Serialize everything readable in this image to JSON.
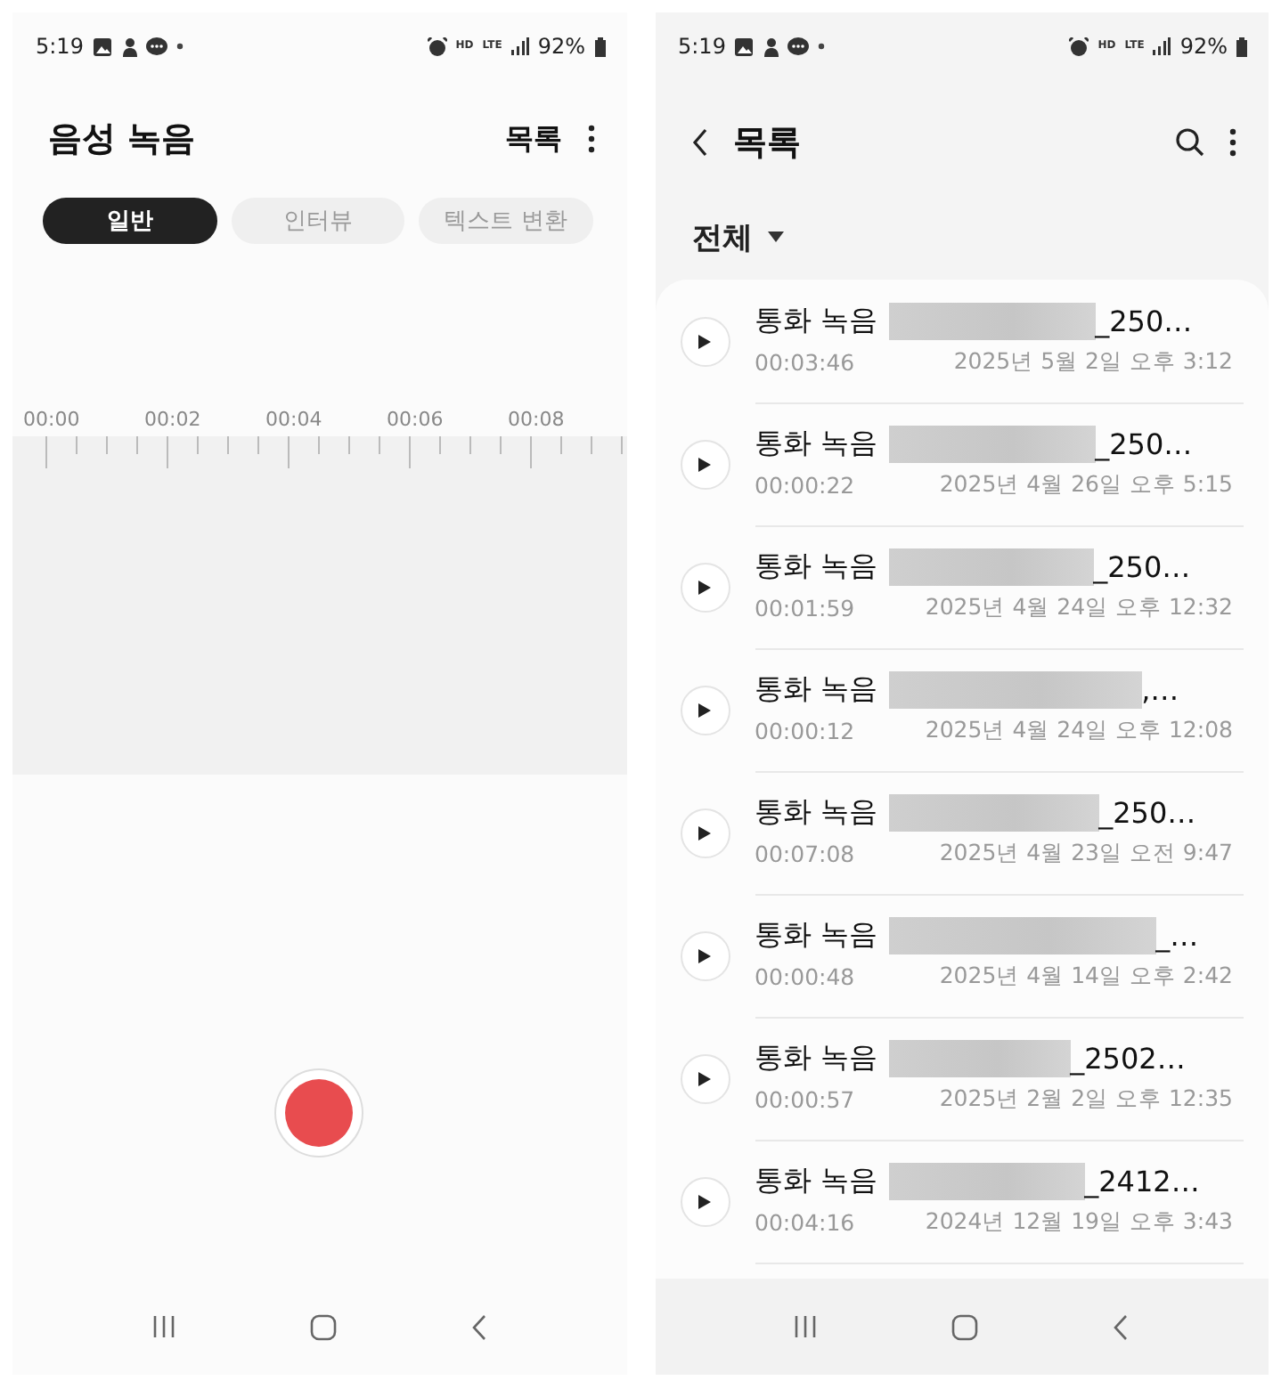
{
  "screens": [
    {
      "status_bar": {
        "time": "5:19",
        "network_labels": [
          "HD",
          "LTE"
        ],
        "battery": "92%"
      },
      "title": "음성 녹음",
      "list_button": "목록",
      "tabs": [
        {
          "label": "일반",
          "selected": true
        },
        {
          "label": "인터뷰",
          "selected": false
        },
        {
          "label": "텍스트 변환",
          "selected": false
        }
      ],
      "timeline": {
        "labels": [
          "00:00",
          "00:02",
          "00:04",
          "00:06",
          "00:08"
        ]
      }
    },
    {
      "status_bar": {
        "time": "5:19",
        "network_labels": [
          "HD",
          "LTE"
        ],
        "battery": "92%"
      },
      "title": "목록",
      "filter": "전체",
      "recordings": [
        {
          "name_prefix": "통화 녹음",
          "name_suffix": "_250…",
          "duration": "00:03:46",
          "date": "2025년 5월 2일 오후 3:12"
        },
        {
          "name_prefix": "통화 녹음",
          "name_suffix": "_250…",
          "duration": "00:00:22",
          "date": "2025년 4월 26일 오후 5:15"
        },
        {
          "name_prefix": "통화 녹음",
          "name_suffix": "_250…",
          "duration": "00:01:59",
          "date": "2025년 4월 24일 오후 12:32"
        },
        {
          "name_prefix": "통화 녹음",
          "name_suffix": ",…",
          "duration": "00:00:12",
          "date": "2025년 4월 24일 오후 12:08"
        },
        {
          "name_prefix": "통화 녹음",
          "name_suffix": "_250…",
          "duration": "00:07:08",
          "date": "2025년 4월 23일 오전 9:47"
        },
        {
          "name_prefix": "통화 녹음",
          "name_suffix": "_…",
          "duration": "00:00:48",
          "date": "2025년 4월 14일 오후 2:42"
        },
        {
          "name_prefix": "통화 녹음",
          "name_suffix": "_2502…",
          "duration": "00:00:57",
          "date": "2025년 2월 2일 오후 12:35"
        },
        {
          "name_prefix": "통화 녹음",
          "name_suffix": "_2412…",
          "duration": "00:04:16",
          "date": "2024년 12월 19일 오후 3:43"
        }
      ]
    }
  ]
}
